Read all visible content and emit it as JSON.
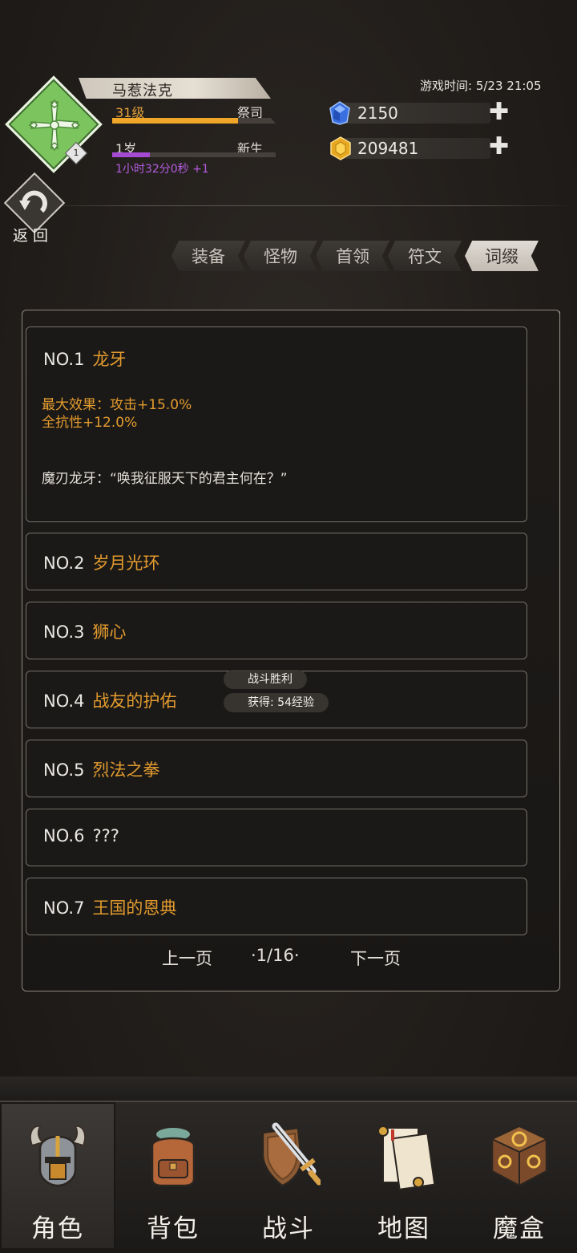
{
  "player": {
    "name": "马惹法克",
    "level": "31级",
    "class": "祭司",
    "exp_fraction": 0.77,
    "age": "1岁",
    "title": "新生",
    "age_fraction": 0.23,
    "playtime": "1小时32分0秒 +1",
    "emblem_badge": "1"
  },
  "game_time": "游戏时间: 5/23 21:05",
  "currency": {
    "gems": "2150",
    "gold": "209481",
    "plus": "✚"
  },
  "back": {
    "label": "返回"
  },
  "tabs": [
    {
      "label": "装备",
      "active": false
    },
    {
      "label": "怪物",
      "active": false
    },
    {
      "label": "首领",
      "active": false
    },
    {
      "label": "符文",
      "active": false
    },
    {
      "label": "词缀",
      "active": true
    }
  ],
  "entries": [
    {
      "no": "NO.1",
      "name": "龙牙",
      "effect_line1": "最大效果：攻击+15.0%",
      "effect_line2": "全抗性+12.0%",
      "quote": "魔刃龙牙：“唤我征服天下的君主何在？”"
    },
    {
      "no": "NO.2",
      "name": "岁月光环"
    },
    {
      "no": "NO.3",
      "name": "狮心"
    },
    {
      "no": "NO.4",
      "name": "战友的护佑"
    },
    {
      "no": "NO.5",
      "name": "烈法之拳"
    },
    {
      "no": "NO.6",
      "name": "???"
    },
    {
      "no": "NO.7",
      "name": "王国的恩典"
    }
  ],
  "pager": {
    "prev": "上一页",
    "page": "·1/16·",
    "next": "下一页"
  },
  "toast": {
    "line1": "战斗胜利",
    "line2": "获得: 54经验"
  },
  "nav": [
    {
      "label": "角色",
      "icon": "helmet-icon",
      "active": true
    },
    {
      "label": "背包",
      "icon": "backpack-icon",
      "active": false
    },
    {
      "label": "战斗",
      "icon": "sword-shield-icon",
      "active": false
    },
    {
      "label": "地图",
      "icon": "scroll-map-icon",
      "active": false
    },
    {
      "label": "魔盒",
      "icon": "magic-box-icon",
      "active": false
    }
  ],
  "colors": {
    "accent_orange": "#e39b2e",
    "exp_bar": "#f0a628",
    "age_bar": "#a44ad3",
    "emblem_green": "#7bc45e"
  }
}
